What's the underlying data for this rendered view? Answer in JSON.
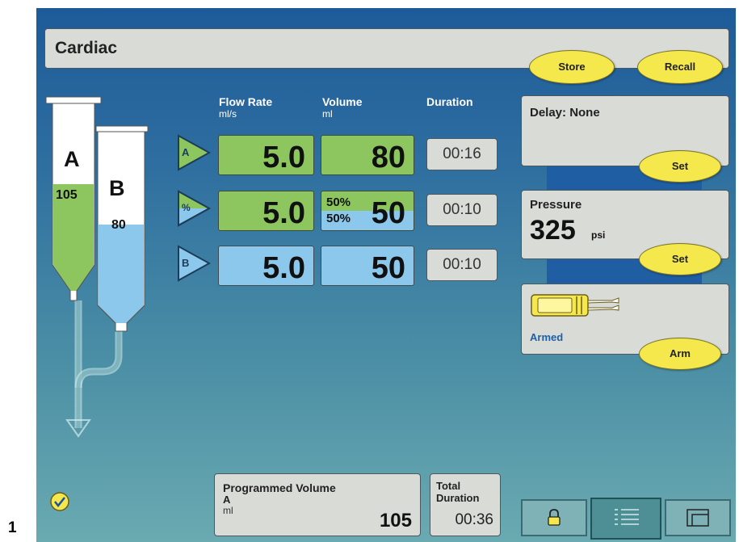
{
  "figure_number": "1",
  "header": {
    "title": "Cardiac",
    "store_label": "Store",
    "recall_label": "Recall"
  },
  "syringes": {
    "a": {
      "letter": "A",
      "volume": "105"
    },
    "b": {
      "letter": "B",
      "volume": "80"
    }
  },
  "columns": {
    "flow_rate": {
      "label": "Flow Rate",
      "unit": "ml/s"
    },
    "volume": {
      "label": "Volume",
      "unit": "ml"
    },
    "duration": {
      "label": "Duration"
    }
  },
  "phases": [
    {
      "icon": "A",
      "flow": "5.0",
      "volume": "80",
      "duration": "00:16"
    },
    {
      "icon": "%",
      "flow": "5.0",
      "pct_a": "50%",
      "pct_b": "50%",
      "volume": "50",
      "duration": "00:10"
    },
    {
      "icon": "B",
      "flow": "5.0",
      "volume": "50",
      "duration": "00:10"
    }
  ],
  "delay": {
    "label": "Delay: None",
    "set_label": "Set"
  },
  "pressure": {
    "label": "Pressure",
    "value": "325",
    "unit": "psi",
    "set_label": "Set"
  },
  "arm": {
    "status": "Armed",
    "arm_label": "Arm"
  },
  "programmed": {
    "title": "Programmed Volume",
    "syringe": "A",
    "unit": "ml",
    "value": "105"
  },
  "total": {
    "label1": "Total",
    "label2": "Duration",
    "value": "00:36"
  },
  "colors": {
    "green": "#8dc65e",
    "blue": "#8cc8eb",
    "yellow": "#f4e84c",
    "armed_text": "#1f5fa8"
  },
  "icons": [
    "check-icon",
    "lock-icon",
    "list-icon",
    "step-icon",
    "syringe-tubing-icon",
    "injector-head-icon"
  ]
}
